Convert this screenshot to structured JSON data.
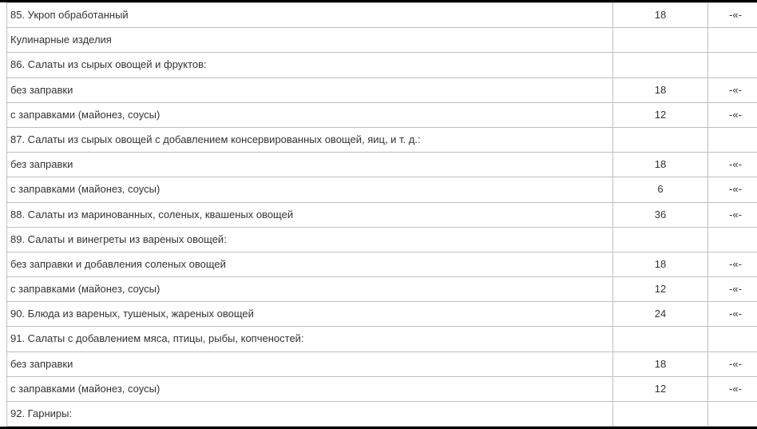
{
  "ditto": "-«-",
  "rows": [
    {
      "name": "85. Укроп обработанный",
      "val": "18",
      "mark": true
    },
    {
      "name": "Кулинарные изделия",
      "val": "",
      "mark": false
    },
    {
      "name": "86. Салаты из сырых овощей и фруктов:",
      "val": "",
      "mark": false
    },
    {
      "name": "без заправки",
      "val": "18",
      "mark": true
    },
    {
      "name": "с заправками (майонез, соусы)",
      "val": "12",
      "mark": true
    },
    {
      "name": "87. Салаты из сырых овощей с добавлением консервированных овощей, яиц, и т. д.:",
      "val": "",
      "mark": false
    },
    {
      "name": "без заправки",
      "val": "18",
      "mark": true
    },
    {
      "name": "с заправками (майонез, соусы)",
      "val": "6",
      "mark": true
    },
    {
      "name": "88. Салаты из маринованных, соленых, квашеных овощей",
      "val": "36",
      "mark": true
    },
    {
      "name": "89. Салаты и винегреты из вареных овощей:",
      "val": "",
      "mark": false
    },
    {
      "name": "без заправки и добавления соленых овощей",
      "val": "18",
      "mark": true
    },
    {
      "name": "с заправками (майонез, соусы)",
      "val": "12",
      "mark": true
    },
    {
      "name": "90. Блюда из вареных, тушеных, жареных овощей",
      "val": "24",
      "mark": true
    },
    {
      "name": "91. Салаты с добавлением мяса, птицы, рыбы, копченостей:",
      "val": "",
      "mark": false
    },
    {
      "name": "без заправки",
      "val": "18",
      "mark": true
    },
    {
      "name": "с заправками (майонез, соусы)",
      "val": "12",
      "mark": true
    },
    {
      "name": "92. Гарниры:",
      "val": "",
      "mark": false
    }
  ]
}
